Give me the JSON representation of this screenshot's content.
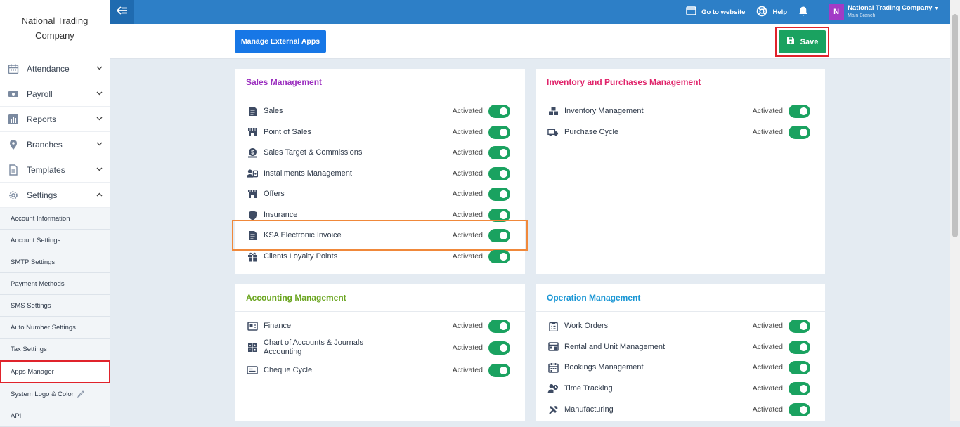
{
  "brand": {
    "line1": "National Trading",
    "line2": "Company"
  },
  "sidebar": {
    "items": [
      {
        "label": "Attendance",
        "icon": "calendar-icon"
      },
      {
        "label": "Payroll",
        "icon": "money-icon"
      },
      {
        "label": "Reports",
        "icon": "chart-icon"
      },
      {
        "label": "Branches",
        "icon": "location-pin-icon"
      },
      {
        "label": "Templates",
        "icon": "document-icon"
      },
      {
        "label": "Settings",
        "icon": "gear-icon"
      }
    ],
    "settings_sub": [
      "Account Information",
      "Account Settings",
      "SMTP Settings",
      "Payment Methods",
      "SMS Settings",
      "Auto Number Settings",
      "Tax Settings",
      "Apps Manager",
      "System Logo & Color",
      "API"
    ]
  },
  "topbar": {
    "go_to_website": "Go to website",
    "help": "Help",
    "user_initial": "N",
    "user_name": "National Trading Company",
    "user_branch": "Main Branch"
  },
  "actions": {
    "manage_external_apps": "Manage External Apps",
    "save": "Save"
  },
  "status_label": "Activated",
  "colors": {
    "sales": "#9b2fbf",
    "inventory": "#e0236a",
    "accounting": "#6aa51f",
    "operation": "#1a96d4",
    "toggle_on": "#1aa260"
  },
  "cards": {
    "sales": {
      "title": "Sales Management",
      "rows": [
        "Sales",
        "Point of Sales",
        "Sales Target & Commissions",
        "Installments Management",
        "Offers",
        "Insurance",
        "KSA Electronic Invoice",
        "Clients Loyalty Points"
      ]
    },
    "inventory": {
      "title": "Inventory and Purchases Management",
      "rows": [
        "Inventory Management",
        "Purchase Cycle"
      ]
    },
    "accounting": {
      "title": "Accounting Management",
      "rows": [
        "Finance",
        "Chart of Accounts & Journals",
        "Accounting",
        "Cheque Cycle"
      ]
    },
    "operation": {
      "title": "Operation Management",
      "rows": [
        "Work Orders",
        "Rental and Unit Management",
        "Bookings Management",
        "Time Tracking",
        "Manufacturing"
      ]
    }
  }
}
